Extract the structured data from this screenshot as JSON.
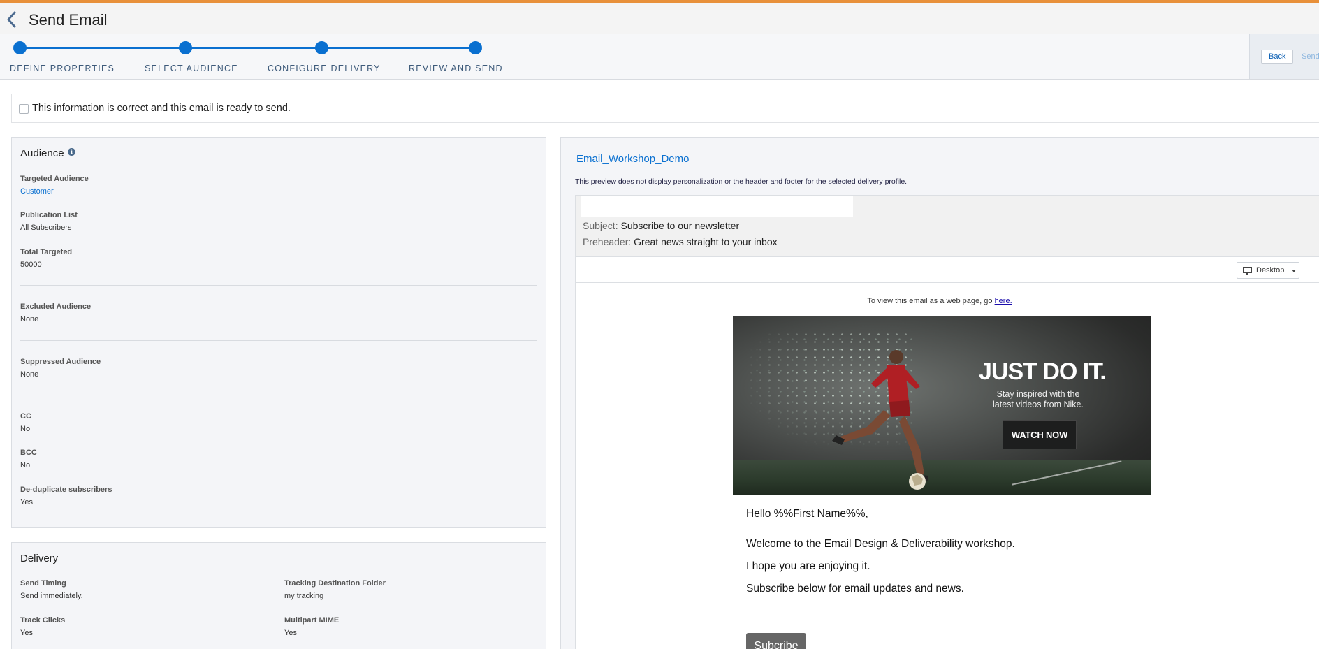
{
  "header": {
    "title": "Send Email"
  },
  "stepper": {
    "steps": [
      {
        "label": "DEFINE PROPERTIES"
      },
      {
        "label": "SELECT AUDIENCE"
      },
      {
        "label": "CONFIGURE DELIVERY"
      },
      {
        "label": "REVIEW AND SEND"
      }
    ],
    "back_label": "Back",
    "send_label": "Send"
  },
  "confirm": {
    "label": "This information is correct and this email is ready to send.",
    "checked": false
  },
  "audience": {
    "title": "Audience",
    "fields": [
      {
        "label": "Targeted Audience",
        "value": "Customer"
      },
      {
        "label": "Publication List",
        "value": "All Subscribers"
      },
      {
        "label": "Total Targeted",
        "value": "50000"
      },
      {
        "label": "Excluded Audience",
        "value": "None"
      },
      {
        "label": "Suppressed Audience",
        "value": "None"
      },
      {
        "label": "CC",
        "value": "No"
      },
      {
        "label": "BCC",
        "value": "No"
      },
      {
        "label": "De-duplicate subscribers",
        "value": "Yes"
      }
    ]
  },
  "delivery": {
    "title": "Delivery",
    "fields": [
      {
        "label": "Send Timing",
        "value": "Send immediately."
      },
      {
        "label": "Tracking Destination Folder",
        "value": "my tracking"
      },
      {
        "label": "Track Clicks",
        "value": "Yes"
      },
      {
        "label": "Multipart MIME",
        "value": "Yes"
      }
    ]
  },
  "preview": {
    "email_name": "Email_Workshop_Demo",
    "note": "This preview does not display personalization or the header and footer for the selected delivery profile.",
    "subject_key": "Subject:",
    "subject": "Subscribe to our newsletter",
    "preheader_key": "Preheader:",
    "preheader": "Great news straight to your inbox",
    "device": "Desktop",
    "web_line": "To view this email as a web page, go",
    "web_link": "here.",
    "hero": {
      "headline": "JUST DO IT.",
      "sub": "Stay inspired with the latest videos from Nike.",
      "button": "WATCH NOW"
    },
    "greeting": "Hello %%First Name%%,",
    "lines": [
      "Welcome to the Email Design & Deliverability workshop.",
      "I hope you are enjoying it.",
      "Subscribe below for email updates and news."
    ],
    "subscribe_button": "Subcribe"
  },
  "colors": {
    "accent": "#e8903a",
    "primary": "#0a70d0"
  }
}
